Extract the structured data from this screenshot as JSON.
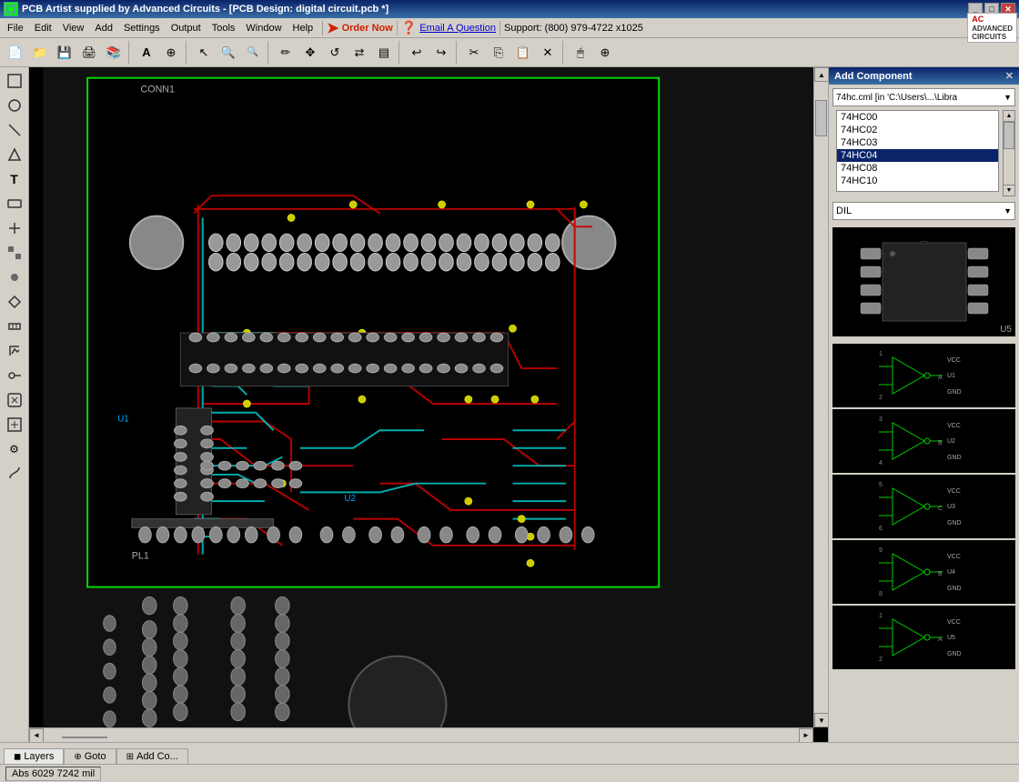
{
  "titlebar": {
    "title": "PCB Artist supplied by Advanced Circuits - [PCB Design: digital circuit.pcb *]",
    "icon": "🔲",
    "buttons": [
      "_",
      "□",
      "✕"
    ]
  },
  "menubar": {
    "items": [
      "File",
      "Edit",
      "View",
      "Add",
      "Settings",
      "Output",
      "Tools",
      "Window",
      "Help"
    ],
    "order_now": "Order Now",
    "email": "Email A Question",
    "support": "Support: (800) 979-4722 x1025",
    "logo": "ADVANCED\nCIRCUITS"
  },
  "add_component": {
    "title": "Add Component",
    "library": "74hc.cml  [in 'C:\\Users\\...\\Libra",
    "components": [
      "74HC00",
      "74HC02",
      "74HC03",
      "74HC04",
      "74HC08",
      "74HC10"
    ],
    "selected": "74HC04",
    "package": "DIL",
    "footprint_label": "U5",
    "close": "✕"
  },
  "bottom_tabs": [
    {
      "label": "Layers",
      "icon": "◼"
    },
    {
      "label": "Goto",
      "icon": "⊕"
    },
    {
      "label": "Add Co...",
      "icon": "⊞"
    }
  ],
  "status": {
    "abs": "Abs",
    "x": "6029",
    "y": "7242",
    "unit": "mil"
  },
  "pcb_labels": {
    "conn1": "CONN1",
    "u1": "U1",
    "u2": "U2",
    "pl1": "PL1"
  },
  "toolbar": {
    "buttons": [
      "📁",
      "💾",
      "🖨",
      "✂",
      "📋",
      "↩",
      "↪",
      "🔍",
      "🔍",
      "✏",
      "⊕",
      "📐",
      "✕",
      "⬚",
      "⬚",
      "🖱"
    ]
  }
}
